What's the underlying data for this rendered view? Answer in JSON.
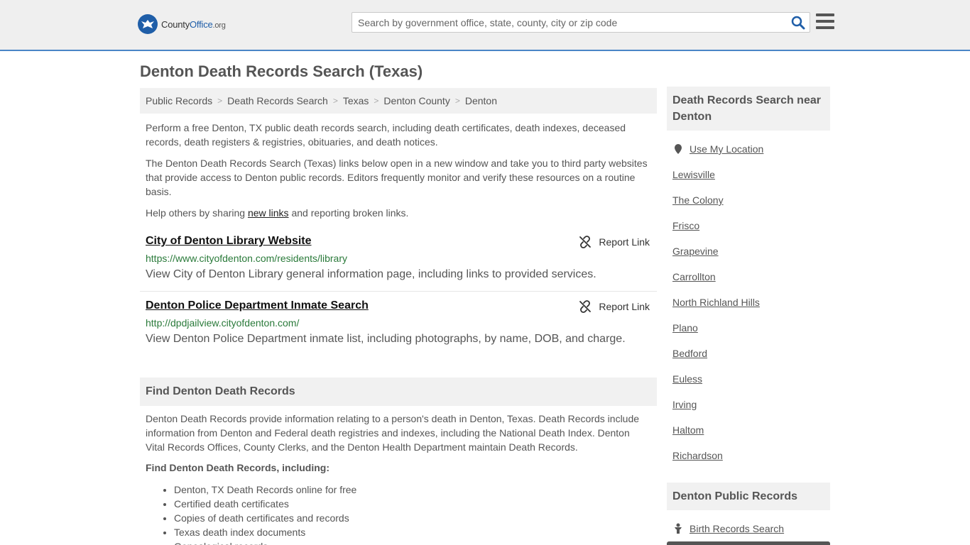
{
  "header": {
    "logo_name": "County",
    "logo_bold": "Office",
    "logo_tld": ".org",
    "search_placeholder": "Search by government office, state, county, city or zip code",
    "accent_color": "#4a86c6",
    "search_icon": "magnifier-icon",
    "menu_icon": "hamburger-icon"
  },
  "page": {
    "title": "Denton Death Records Search (Texas)"
  },
  "breadcrumb": [
    "Public Records",
    "Death Records Search",
    "Texas",
    "Denton County",
    "Denton"
  ],
  "intro": {
    "p1": "Perform a free Denton, TX public death records search, including death certificates, death indexes, deceased records, death registers & registries, obituaries, and death notices.",
    "p2": "The Denton Death Records Search (Texas) links below open in a new window and take you to third party websites that provide access to Denton public records. Editors frequently monitor and verify these resources on a routine basis.",
    "p3_before": "Help others by sharing ",
    "p3_link": "new links",
    "p3_after": " and reporting broken links."
  },
  "results": [
    {
      "title": "City of Denton Library Website",
      "url": "https://www.cityofdenton.com/residents/library",
      "desc": "View City of Denton Library general information page, including links to provided services.",
      "report": "Report Link"
    },
    {
      "title": "Denton Police Department Inmate Search",
      "url": "http://dpdjailview.cityofdenton.com/",
      "desc": "View Denton Police Department inmate list, including photographs, by name, DOB, and charge.",
      "report": "Report Link"
    }
  ],
  "find": {
    "heading": "Find Denton Death Records",
    "body": "Denton Death Records provide information relating to a person's death in Denton, Texas. Death Records include information from Denton and Federal death registries and indexes, including the National Death Index. Denton Vital Records Offices, County Clerks, and the Denton Health Department maintain Death Records.",
    "subhead": "Find Denton Death Records, including:",
    "items": [
      "Denton, TX Death Records online for free",
      "Certified death certificates",
      "Copies of death certificates and records",
      "Texas death index documents",
      "Genealogical records"
    ]
  },
  "sidebar": {
    "near_heading": "Death Records Search near Denton",
    "use_location": "Use My Location",
    "cities": [
      "Lewisville",
      "The Colony",
      "Frisco",
      "Grapevine",
      "Carrollton",
      "North Richland Hills",
      "Plano",
      "Bedford",
      "Euless",
      "Irving",
      "Haltom",
      "Richardson"
    ],
    "public_heading": "Denton Public Records",
    "birth_link": "Birth Records Search"
  }
}
